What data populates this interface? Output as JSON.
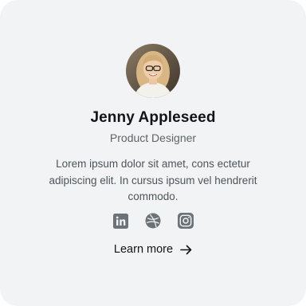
{
  "profile": {
    "name": "Jenny Appleseed",
    "role": "Product Designer",
    "bio": "Lorem ipsum dolor sit amet, cons ectetur adipiscing elit. In cursus ipsum vel hendrerit commodo."
  },
  "socials": [
    {
      "icon": "linkedin-icon"
    },
    {
      "icon": "dribbble-icon"
    },
    {
      "icon": "instagram-icon"
    }
  ],
  "cta": {
    "label": "Learn more",
    "icon": "arrow-right-icon"
  },
  "colors": {
    "card_background": "#f2f3f4",
    "icon": "#6b7378",
    "text_primary": "#111418",
    "text_secondary": "#5e6468"
  }
}
